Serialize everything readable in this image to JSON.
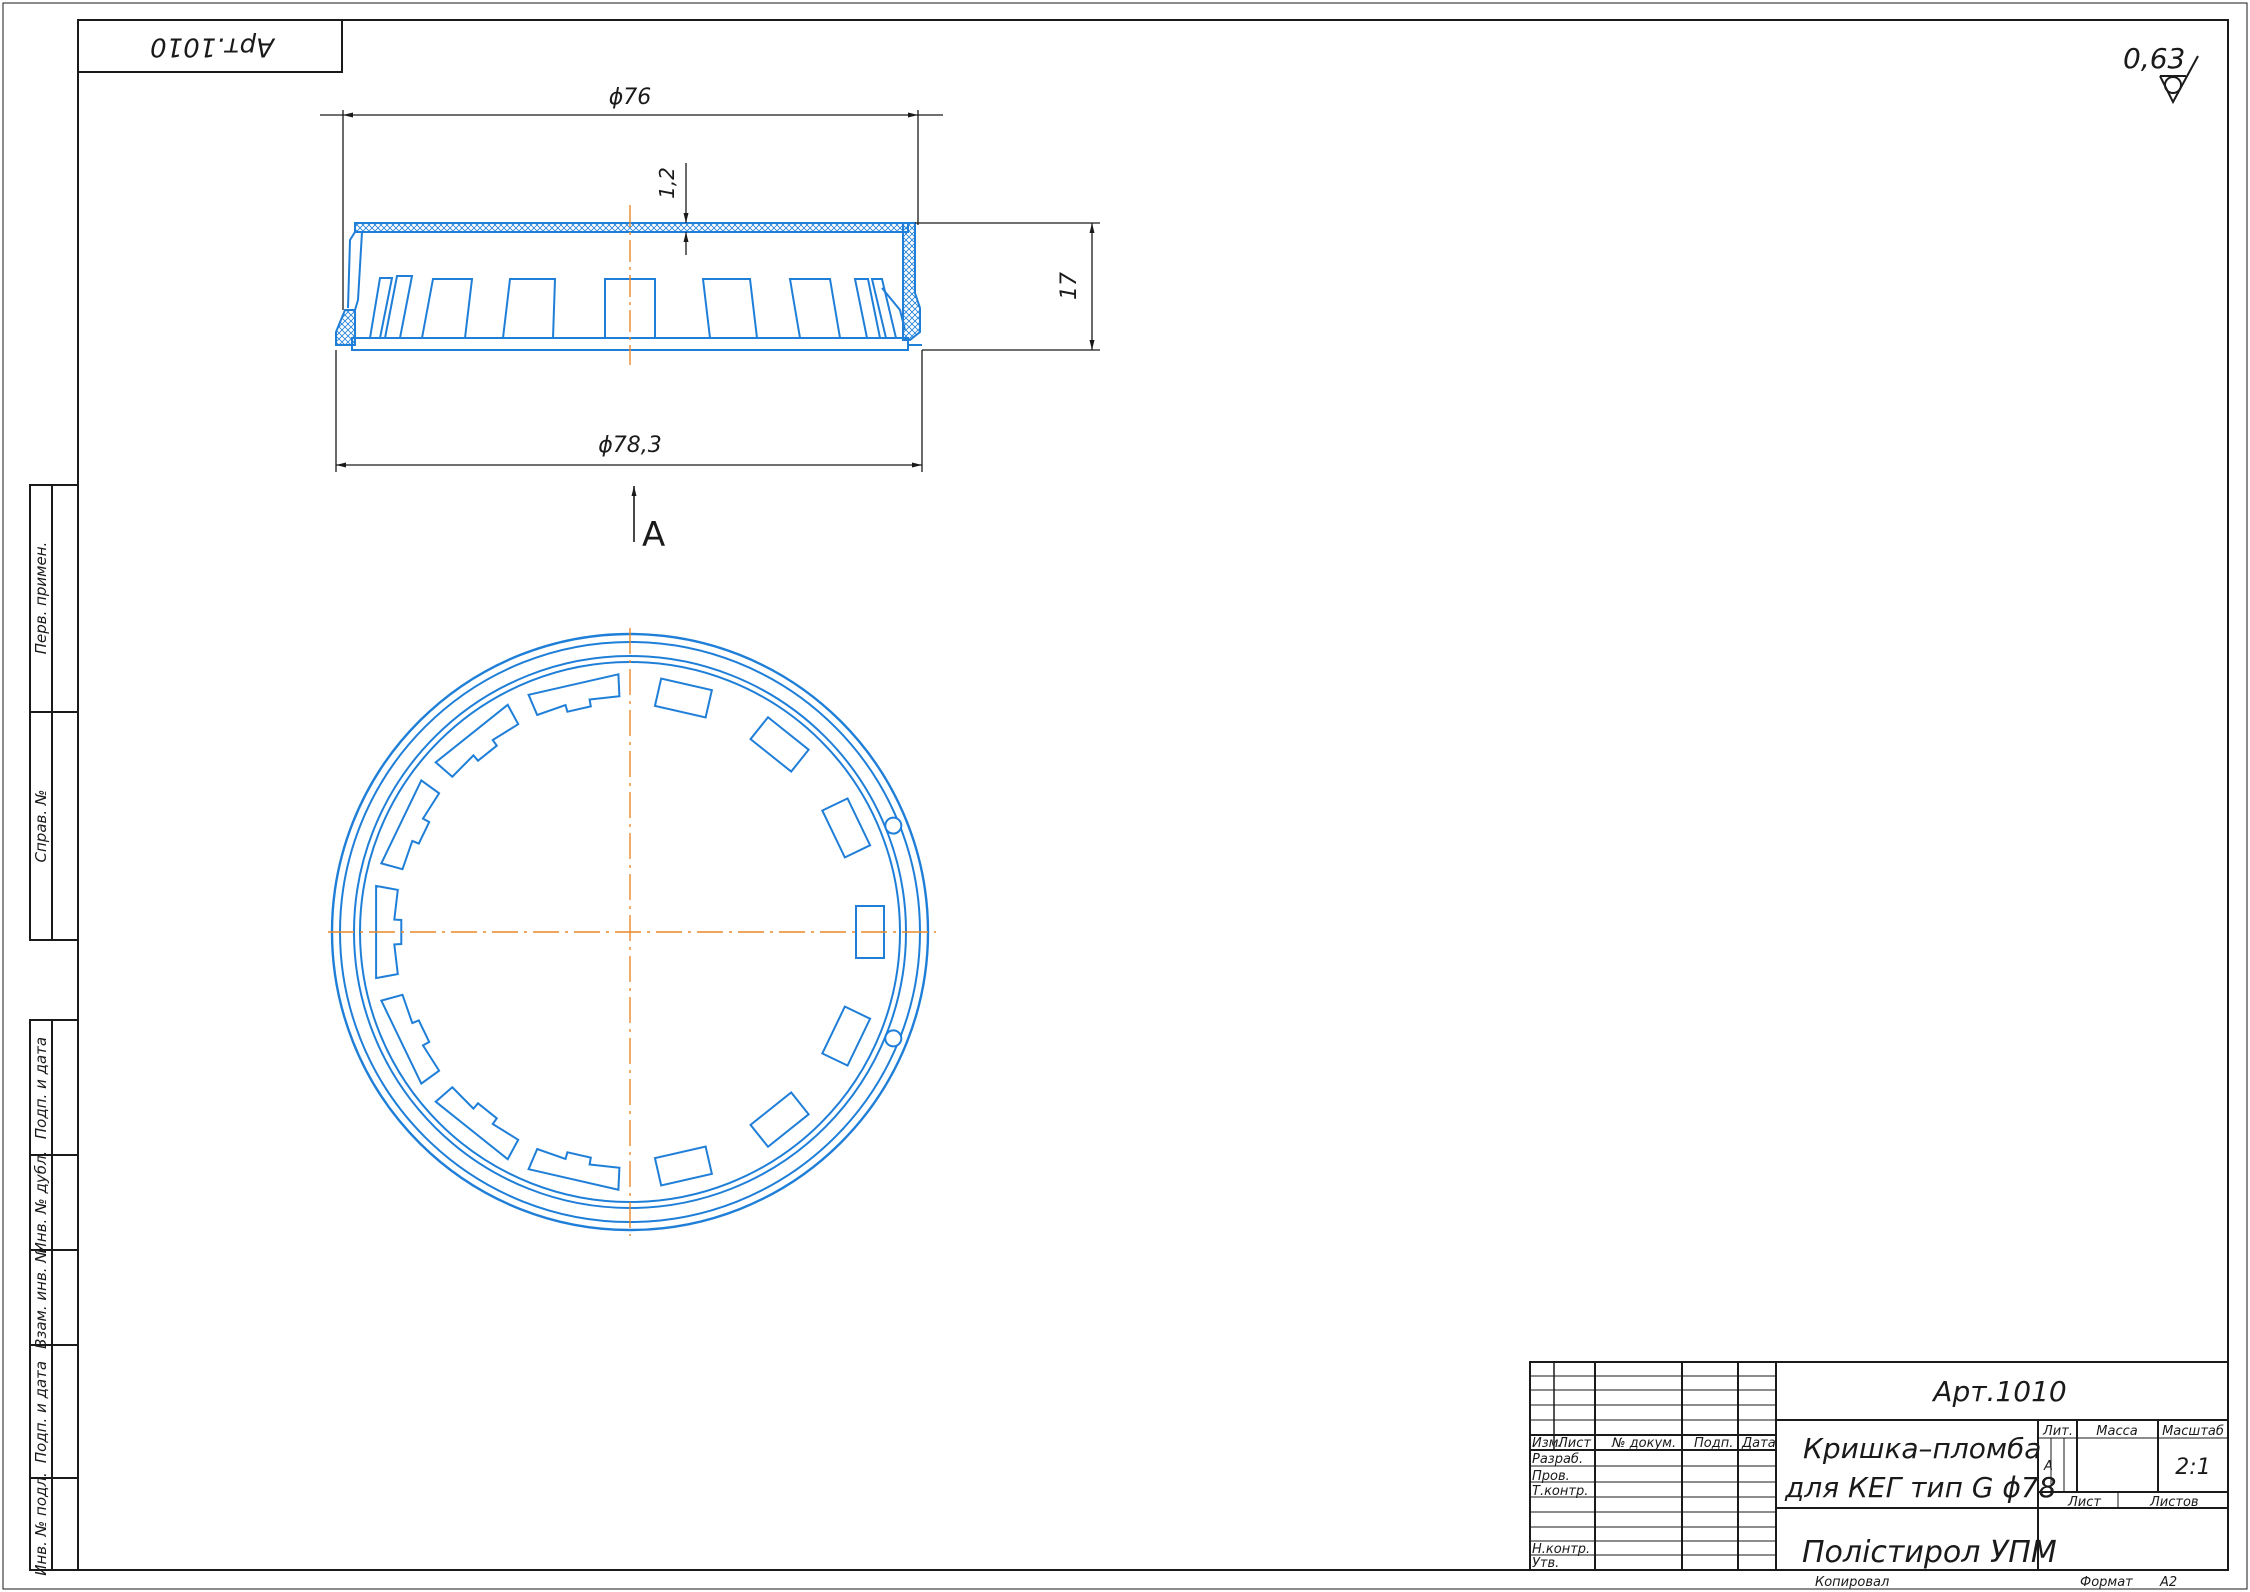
{
  "stamp": {
    "doc_code_rotated": "Арт.1010"
  },
  "roughness": {
    "value": "0,63"
  },
  "dimensions": {
    "top_diameter": "ϕ76",
    "bottom_diameter": "ϕ78,3",
    "wall_thickness": "1,2",
    "height": "17"
  },
  "view_marker": {
    "label": "А"
  },
  "side_columns": {
    "perv_primen": "Перв. примен.",
    "sprav_no": "Справ. №",
    "podp_data_1": "Подп. и дата",
    "inv_dubl": "Инв. № дубл.",
    "vzam_inv": "Взам. инв. №",
    "podp_data_2": "Подп. и дата",
    "inv_podl": "Инв. № подл."
  },
  "title_block": {
    "doc_code": "Арт.1010",
    "name_line1": "Кришка–пломба",
    "name_line2": "для КЕГ тип G ϕ78",
    "material": "Полістирол УПМ",
    "hdr_izm": "Изм.",
    "hdr_list": "Лист",
    "hdr_dokum": "№ докум.",
    "hdr_podp": "Подп.",
    "hdr_data": "Дата",
    "row_razrab": "Разраб.",
    "row_prov": "Пров.",
    "row_tkontr": "Т.контр.",
    "row_nkontr": "Н.контр.",
    "row_utv": "Утв.",
    "lit_label": "Лит.",
    "mass_label": "Масса",
    "scale_label": "Масштаб",
    "lit_value": "А",
    "scale_value": "2:1",
    "sheet_label": "Лист",
    "sheets_label": "Листов",
    "copied_label": "Копировал",
    "format_label": "Формат",
    "format_value": "А2"
  },
  "colors": {
    "line": "#1a1a1a",
    "part": "#1f7fd8",
    "center": "#e8892a"
  },
  "segments": {
    "start_deg": 180,
    "wide_count": 7,
    "narrow_count": 7,
    "notch_angles_deg": [
      22,
      338
    ]
  }
}
